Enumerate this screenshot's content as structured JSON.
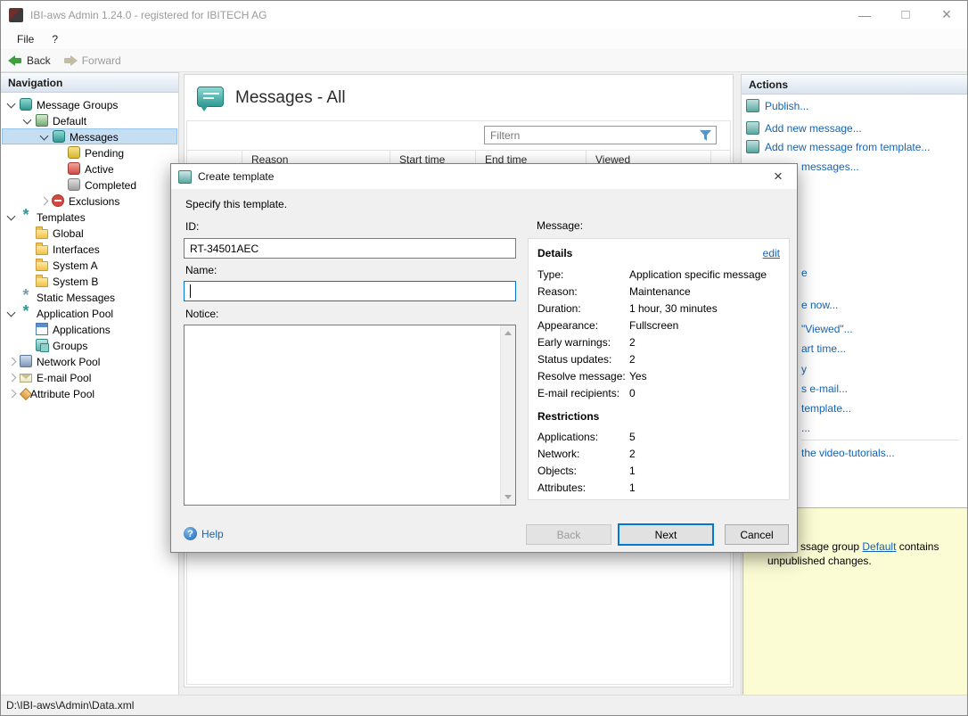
{
  "window": {
    "title": "IBI-aws Admin 1.24.0 - registered for IBITECH AG"
  },
  "menu": {
    "items": [
      "File",
      "?"
    ]
  },
  "toolbar": {
    "back": "Back",
    "forward": "Forward"
  },
  "navigation": {
    "header": "Navigation",
    "tree": [
      {
        "label": "Message Groups",
        "level": 0,
        "icon": "messages",
        "chevron": "down"
      },
      {
        "label": "Default",
        "level": 1,
        "icon": "group",
        "chevron": "down"
      },
      {
        "label": "Messages",
        "level": 2,
        "icon": "messages",
        "chevron": "down",
        "selected": true
      },
      {
        "label": "Pending",
        "level": 3,
        "icon": "msg-yellow"
      },
      {
        "label": "Active",
        "level": 3,
        "icon": "msg-red"
      },
      {
        "label": "Completed",
        "level": 3,
        "icon": "msg-gray"
      },
      {
        "label": "Exclusions",
        "level": 2,
        "icon": "exclusion",
        "chevron": "right"
      },
      {
        "label": "Templates",
        "level": 0,
        "icon": "template",
        "chevron": "down"
      },
      {
        "label": "Global",
        "level": 1,
        "icon": "folder"
      },
      {
        "label": "Interfaces",
        "level": 1,
        "icon": "folder"
      },
      {
        "label": "System A",
        "level": 1,
        "icon": "folder"
      },
      {
        "label": "System B",
        "level": 1,
        "icon": "folder"
      },
      {
        "label": "Static Messages",
        "level": 0,
        "icon": "static"
      },
      {
        "label": "Application Pool",
        "level": 0,
        "icon": "pool",
        "chevron": "down"
      },
      {
        "label": "Applications",
        "level": 1,
        "icon": "app-window"
      },
      {
        "label": "Groups",
        "level": 1,
        "icon": "groups"
      },
      {
        "label": "Network Pool",
        "level": 0,
        "icon": "network",
        "chevron": "right"
      },
      {
        "label": "E-mail Pool",
        "level": 0,
        "icon": "mail",
        "chevron": "right"
      },
      {
        "label": "Attribute Pool",
        "level": 0,
        "icon": "attribute",
        "chevron": "right"
      }
    ]
  },
  "main": {
    "title": "Messages - All",
    "filter_placeholder": "Filtern",
    "columns": [
      "Reason",
      "Start time",
      "End time",
      "Viewed"
    ]
  },
  "actions": {
    "header": "Actions",
    "links": [
      {
        "label": "Publish..."
      },
      {
        "label": "Add new message..."
      },
      {
        "label": "Add new message from template..."
      }
    ],
    "fragments": [
      "messages...",
      "e",
      "e now...",
      "\"Viewed\"...",
      "art time...",
      "y",
      "s e-mail...",
      "template...",
      "...",
      "the video-tutorials..."
    ],
    "notice": {
      "line1_pre": "ssage group ",
      "line1_link": "Default",
      "line1_post": " contains",
      "line2": "unpublished changes."
    }
  },
  "dialog": {
    "title": "Create template",
    "intro": "Specify this template.",
    "fields": {
      "id": {
        "label": "ID:",
        "value": "RT-34501AEC"
      },
      "name": {
        "label": "Name:",
        "value": ""
      },
      "notice": {
        "label": "Notice:",
        "value": ""
      }
    },
    "message_label": "Message:",
    "details": {
      "heading": "Details",
      "edit_link": "edit",
      "rows": [
        {
          "label": "Type:",
          "value": "Application specific message"
        },
        {
          "label": "Reason:",
          "value": "Maintenance"
        },
        {
          "label": "Duration:",
          "value": "1 hour, 30 minutes"
        },
        {
          "label": "Appearance:",
          "value": "Fullscreen"
        },
        {
          "label": "Early warnings:",
          "value": "2"
        },
        {
          "label": "Status updates:",
          "value": "2"
        },
        {
          "label": "Resolve message:",
          "value": "Yes"
        },
        {
          "label": "E-mail recipients:",
          "value": "0"
        }
      ],
      "restrictions_heading": "Restrictions",
      "restriction_rows": [
        {
          "label": "Applications:",
          "value": "5"
        },
        {
          "label": "Network:",
          "value": "2"
        },
        {
          "label": "Objects:",
          "value": "1"
        },
        {
          "label": "Attributes:",
          "value": "1"
        }
      ]
    },
    "buttons": {
      "help": "Help",
      "back": "Back",
      "next": "Next",
      "cancel": "Cancel"
    }
  },
  "statusbar": {
    "path": "D:\\IBI-aws\\Admin\\Data.xml"
  }
}
